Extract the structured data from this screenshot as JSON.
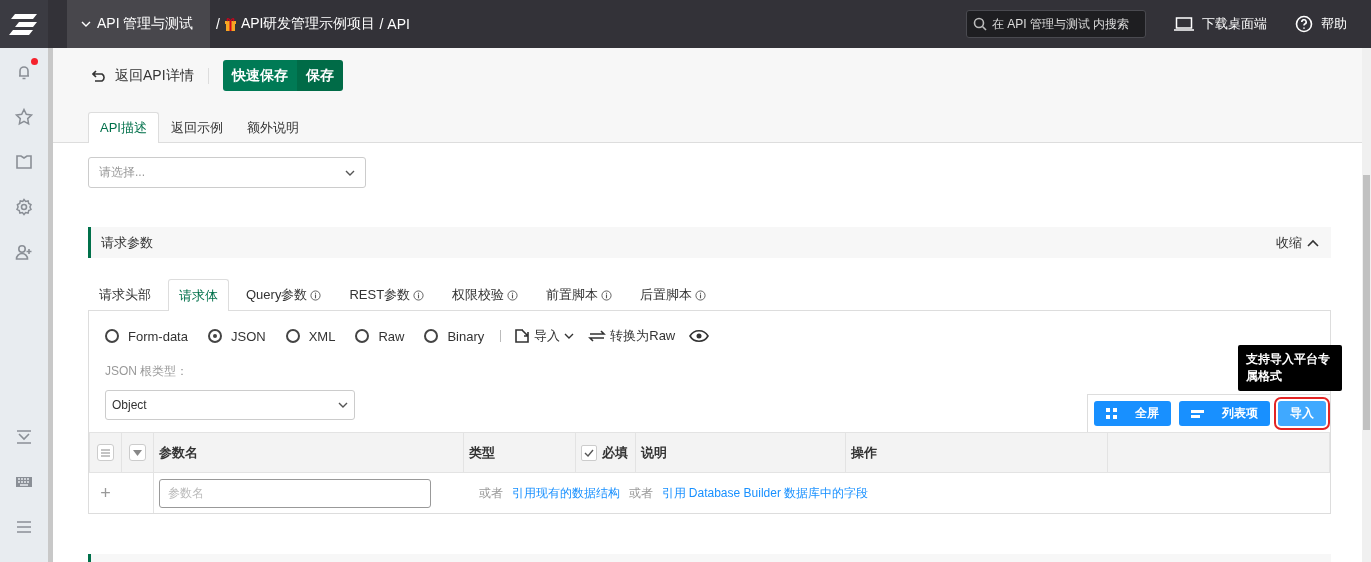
{
  "header": {
    "app_menu": "API 管理与测试",
    "separator": "/",
    "breadcrumb": [
      {
        "label": "API研发管理示例项目"
      },
      {
        "label": "API"
      }
    ],
    "search": {
      "placeholder": "在 API 管理与测试 内搜索"
    },
    "download": "下载桌面端",
    "help": "帮助"
  },
  "sidebar": {
    "top": [
      {
        "kind": "bell",
        "notification": true
      },
      {
        "kind": "star",
        "notification": false
      },
      {
        "kind": "shirt",
        "notification": false
      },
      {
        "kind": "gear",
        "notification": false
      },
      {
        "kind": "user-add",
        "notification": false
      }
    ],
    "bottom": [
      {
        "kind": "tray"
      },
      {
        "kind": "keyboard"
      },
      {
        "kind": "menu"
      }
    ]
  },
  "toolbar": {
    "back": "返回API详情",
    "buttons": [
      {
        "label": "快速保存",
        "primary": true
      },
      {
        "label": "保存",
        "primary": false
      }
    ]
  },
  "tabs": [
    {
      "label": "API描述",
      "selected": true
    },
    {
      "label": "返回示例",
      "selected": false
    },
    {
      "label": "额外说明",
      "selected": false
    }
  ],
  "owner_select": {
    "placeholder": "请选择..."
  },
  "request_section": {
    "title": "请求参数",
    "collapse": "收缩",
    "tabs": [
      {
        "label": "请求头部",
        "selected": false,
        "info": false
      },
      {
        "label": "请求体",
        "selected": true,
        "info": false
      },
      {
        "label": "Query参数",
        "selected": false,
        "info": true
      },
      {
        "label": "REST参数",
        "selected": false,
        "info": true
      },
      {
        "label": "权限校验",
        "selected": false,
        "info": true
      },
      {
        "label": "前置脚本",
        "selected": false,
        "info": true
      },
      {
        "label": "后置脚本",
        "selected": false,
        "info": true
      }
    ],
    "body_types": [
      {
        "label": "Form-data",
        "selected": false
      },
      {
        "label": "JSON",
        "selected": true
      },
      {
        "label": "XML",
        "selected": false
      },
      {
        "label": "Raw",
        "selected": false
      },
      {
        "label": "Binary",
        "selected": false
      }
    ],
    "import": "导入",
    "convert": "转换为Raw",
    "root_type_label": "JSON 根类型：",
    "root_type": "Object",
    "actions": [
      {
        "label": "全屏",
        "highlighted": false
      },
      {
        "label": "列表项",
        "highlighted": false
      },
      {
        "label": "导入",
        "highlighted": true
      }
    ],
    "tooltip": "支持导入平台专属格式",
    "table": {
      "columns": [
        {
          "label": "参数名",
          "kind": "text"
        },
        {
          "label": "类型",
          "kind": "text"
        },
        {
          "label": "必填",
          "kind": "checkbox",
          "checked": true
        },
        {
          "label": "说明",
          "kind": "text"
        },
        {
          "label": "操作",
          "kind": "text"
        }
      ],
      "new_row": {
        "add": "+",
        "placeholder": "参数名",
        "hints": [
          {
            "text": "或者",
            "link": false
          },
          {
            "text": "引用现有的数据结构",
            "link": true
          },
          {
            "text": "或者",
            "link": false
          },
          {
            "text": "引用 Database Builder 数据库中的字段",
            "link": true
          }
        ]
      }
    }
  }
}
